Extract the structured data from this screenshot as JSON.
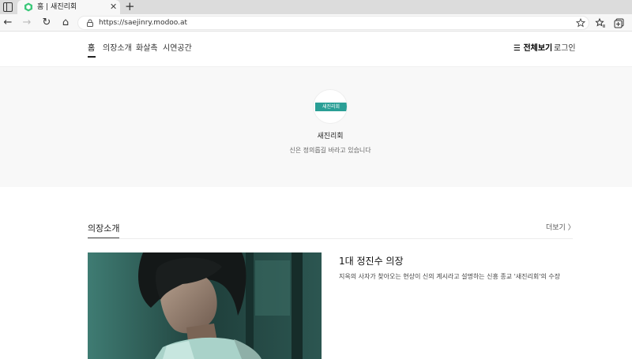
{
  "browser": {
    "tab_title": "홈 | 새진리회",
    "close_glyph": "✕",
    "new_tab_glyph": "+",
    "url": "https://saejinry.modoo.at",
    "back_glyph": "←",
    "forward_glyph": "→",
    "reload_glyph": "↻",
    "home_glyph": "⌂"
  },
  "nav": {
    "items": [
      "홈",
      "의장소개",
      "화살촉",
      "시연공간"
    ],
    "menu_all": "☰ 전체보기",
    "login": "로그인"
  },
  "hero": {
    "logo_text": "새진리회",
    "site_name": "새진리회",
    "tagline": "신은 정의롭길 바라고 있습니다"
  },
  "section": {
    "title": "의장소개",
    "more": "더보기 〉"
  },
  "card": {
    "title": "1대 정진수 의장",
    "description": "지옥의 사자가 찾아오는 현상이 신의 계시라고 설명하는 신흥 종교 '새진리회'의 수장"
  },
  "colors": {
    "accent": "#2a9f96",
    "hero_bg": "#f8f8f8"
  }
}
